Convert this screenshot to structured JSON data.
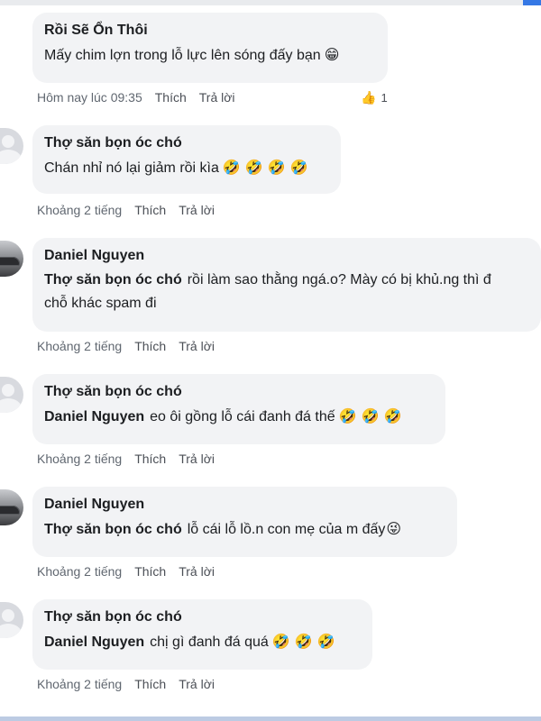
{
  "comments": [
    {
      "author": "Rồi Sẽ Ổn Thôi",
      "mention": "",
      "text": "Mấy chim lợn trong lỗ lực lên sóng đấy bạn",
      "emoji": "😁",
      "time": "Hôm nay lúc 09:35",
      "like": "Thích",
      "reply": "Trả lời",
      "reaction_count": "1",
      "avatar": "none"
    },
    {
      "author": "Thợ săn bọn óc chó",
      "mention": "",
      "text": "Chán nhỉ nó lại giảm rồi kìa",
      "emoji": "🤣 🤣 🤣 🤣",
      "time": "Khoảng 2 tiếng",
      "like": "Thích",
      "reply": "Trả lời",
      "avatar": "default"
    },
    {
      "author": "Daniel Nguyen",
      "mention": "Thợ săn bọn óc chó",
      "text": "rồi làm sao thằng ngá.o? Mày có bị khủ.ng thì đ",
      "text2": "chỗ khác spam đi",
      "time": "Khoảng 2 tiếng",
      "like": "Thích",
      "reply": "Trả lời",
      "avatar": "photo"
    },
    {
      "author": "Thợ săn bọn óc chó",
      "mention": "Daniel Nguyen",
      "text": "eo ôi gồng lỗ cái đanh đá thế",
      "emoji": "🤣 🤣 🤣",
      "time": "Khoảng 2 tiếng",
      "like": "Thích",
      "reply": "Trả lời",
      "avatar": "default"
    },
    {
      "author": "Daniel Nguyen",
      "mention": "Thợ săn bọn óc chó",
      "text": "lỗ cái lỗ lồ.n con mẹ của m đấy",
      "emoji": "😜",
      "time": "Khoảng 2 tiếng",
      "like": "Thích",
      "reply": "Trả lời",
      "avatar": "photo"
    },
    {
      "author": "Thợ săn bọn óc chó",
      "mention": "Daniel Nguyen",
      "text": "chị gì đanh đá quá",
      "emoji": "🤣 🤣 🤣",
      "time": "Khoảng 2 tiếng",
      "like": "Thích",
      "reply": "Trả lời",
      "avatar": "default"
    }
  ],
  "colors": {
    "bubble": "#f2f3f5",
    "meta_text": "#606770",
    "like_blue": "#2d88ff"
  }
}
